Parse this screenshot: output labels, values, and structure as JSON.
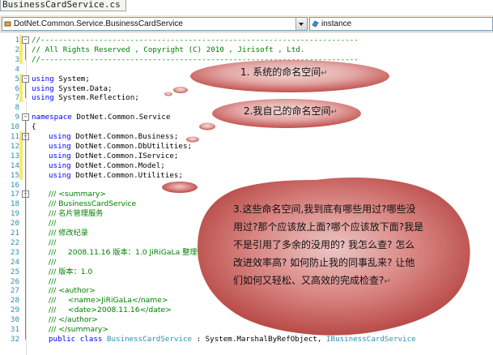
{
  "window": {
    "tab_title": "BusinessCardService.cs"
  },
  "navbar": {
    "class_combo": "DotNet.Common.Service.BusinessCardService",
    "member_combo": "instance"
  },
  "code": {
    "lines": [
      {
        "n": "1",
        "text": "//-----------------------------------------------------------------------"
      },
      {
        "n": "2",
        "text": "// All Rights Reserved , Copyright (C) 2010 , Jirisoft , Ltd."
      },
      {
        "n": "3",
        "text": "//-----------------------------------------------------------------------"
      },
      {
        "n": "4",
        "text": ""
      },
      {
        "n": "5",
        "kw": "using",
        "rest": " System;"
      },
      {
        "n": "6",
        "kw": "using",
        "rest": " System.Data;"
      },
      {
        "n": "7",
        "kw": "using",
        "rest": " System.Reflection;"
      },
      {
        "n": "8",
        "text": ""
      },
      {
        "n": "9",
        "kw": "namespace",
        "rest": " DotNet.Common.Service"
      },
      {
        "n": "10",
        "text": "{"
      },
      {
        "n": "11",
        "kw": "using",
        "rest": " DotNet.Common.Business;"
      },
      {
        "n": "12",
        "kw": "using",
        "rest": " DotNet.Common.DbUtilities;"
      },
      {
        "n": "13",
        "kw": "using",
        "rest": " DotNet.Common.IService;"
      },
      {
        "n": "14",
        "kw": "using",
        "rest": " DotNet.Common.Model;"
      },
      {
        "n": "15",
        "kw": "using",
        "rest": " DotNet.Common.Utilities;"
      },
      {
        "n": "16",
        "text": ""
      },
      {
        "n": "17",
        "text": "/// <summary>"
      },
      {
        "n": "18",
        "text": "/// BusinessCardService"
      },
      {
        "n": "19",
        "text": "/// 名片管理服务"
      },
      {
        "n": "20",
        "text": "///"
      },
      {
        "n": "21",
        "text": "/// 修改纪录"
      },
      {
        "n": "22",
        "text": "///"
      },
      {
        "n": "23",
        "text": "///     2008.11.16 版本：1.0 JiRiGaLa 整理代码。"
      },
      {
        "n": "24",
        "text": "///"
      },
      {
        "n": "25",
        "text": "/// 版本：1.0"
      },
      {
        "n": "26",
        "text": "///"
      },
      {
        "n": "27",
        "text": "/// <author>"
      },
      {
        "n": "28",
        "text": "///     <name>JiRiGaLa</name>"
      },
      {
        "n": "29",
        "text": "///     <date>2008.11.16</date>"
      },
      {
        "n": "30",
        "text": "/// </author>"
      },
      {
        "n": "31",
        "text": "/// </summary>"
      },
      {
        "n": "32",
        "text": "public class BusinessCardService : System.MarshalByRefObject, IBusinessCardService"
      }
    ]
  },
  "callouts": {
    "c1": "1. 系统的命名空间",
    "c2": "2.我自己的命名空间",
    "c3": "3.这些命名空间,我到底有哪些用过?哪些没用过?那个应该放上面?哪个应该放下面?我是不是引用了多余的没用的? 我怎么查? 怎么改进效率高? 如何防止我的同事乱来? 让他们如何又轻松、又高效的完成检查?",
    "para_mark": "↵"
  },
  "colors": {
    "callout_fill": "#c0504d",
    "callout_mid": "#e6b9b8",
    "keyword": "#0000ff",
    "comment": "#008000",
    "line_number": "#2b91af"
  }
}
